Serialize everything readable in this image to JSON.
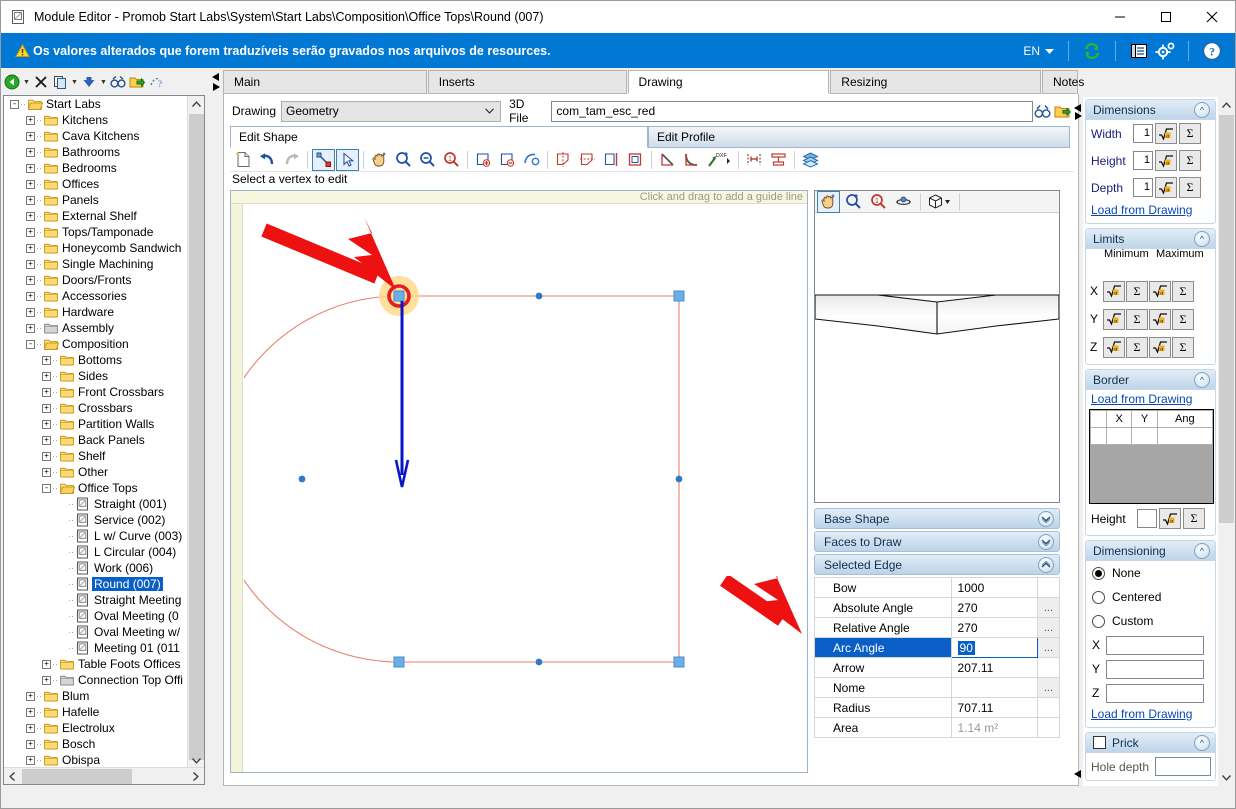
{
  "window": {
    "title": "Module Editor - Promob Start Labs\\System\\Start Labs\\Composition\\Office Tops\\Round (007)",
    "minimize": "—",
    "maximize": "☐",
    "close": "✕"
  },
  "notification": {
    "message": "Os valores alterados que forem traduzíveis serão gravados nos arquivos de resources.",
    "language": "EN",
    "icons": [
      "refresh-icon",
      "report-icon",
      "settings-icon",
      "help-icon"
    ]
  },
  "left_toolbar": {
    "buttons": [
      "back-icon",
      "delete-icon",
      "copy-icon",
      "move-down-icon",
      "find-icon",
      "export-icon",
      "unknown-icon"
    ]
  },
  "tree": {
    "root": "Start Labs",
    "items": [
      {
        "label": "Start Labs",
        "depth": 0,
        "exp": "-",
        "icon": "open-folder",
        "selected": false
      },
      {
        "label": "Kitchens",
        "depth": 1,
        "exp": "+",
        "icon": "folder",
        "selected": false
      },
      {
        "label": "Cava Kitchens",
        "depth": 1,
        "exp": "+",
        "icon": "folder",
        "selected": false
      },
      {
        "label": "Bathrooms",
        "depth": 1,
        "exp": "+",
        "icon": "folder",
        "selected": false
      },
      {
        "label": "Bedrooms",
        "depth": 1,
        "exp": "+",
        "icon": "folder",
        "selected": false
      },
      {
        "label": "Offices",
        "depth": 1,
        "exp": "+",
        "icon": "folder",
        "selected": false
      },
      {
        "label": "Panels",
        "depth": 1,
        "exp": "+",
        "icon": "folder",
        "selected": false
      },
      {
        "label": "External Shelf",
        "depth": 1,
        "exp": "+",
        "icon": "folder",
        "selected": false
      },
      {
        "label": "Tops/Tamponade",
        "depth": 1,
        "exp": "+",
        "icon": "folder",
        "selected": false
      },
      {
        "label": "Honeycomb Sandwich",
        "depth": 1,
        "exp": "+",
        "icon": "folder",
        "selected": false
      },
      {
        "label": "Single Machining",
        "depth": 1,
        "exp": "+",
        "icon": "folder",
        "selected": false
      },
      {
        "label": "Doors/Fronts",
        "depth": 1,
        "exp": "+",
        "icon": "folder",
        "selected": false
      },
      {
        "label": "Accessories",
        "depth": 1,
        "exp": "+",
        "icon": "folder",
        "selected": false
      },
      {
        "label": "Hardware",
        "depth": 1,
        "exp": "+",
        "icon": "folder",
        "selected": false
      },
      {
        "label": "Assembly",
        "depth": 1,
        "exp": "+",
        "icon": "folder-grey",
        "selected": false
      },
      {
        "label": "Composition",
        "depth": 1,
        "exp": "-",
        "icon": "open-folder",
        "selected": false
      },
      {
        "label": "Bottoms",
        "depth": 2,
        "exp": "+",
        "icon": "folder",
        "selected": false
      },
      {
        "label": "Sides",
        "depth": 2,
        "exp": "+",
        "icon": "folder",
        "selected": false
      },
      {
        "label": "Front Crossbars",
        "depth": 2,
        "exp": "+",
        "icon": "folder",
        "selected": false
      },
      {
        "label": "Crossbars",
        "depth": 2,
        "exp": "+",
        "icon": "folder",
        "selected": false
      },
      {
        "label": "Partition Walls",
        "depth": 2,
        "exp": "+",
        "icon": "folder",
        "selected": false
      },
      {
        "label": "Back Panels",
        "depth": 2,
        "exp": "+",
        "icon": "folder",
        "selected": false
      },
      {
        "label": "Shelf",
        "depth": 2,
        "exp": "+",
        "icon": "folder",
        "selected": false
      },
      {
        "label": "Other",
        "depth": 2,
        "exp": "+",
        "icon": "folder",
        "selected": false
      },
      {
        "label": "Office Tops",
        "depth": 2,
        "exp": "-",
        "icon": "open-folder",
        "selected": false
      },
      {
        "label": "Straight (001)",
        "depth": 3,
        "exp": "",
        "icon": "module",
        "selected": false
      },
      {
        "label": "Service (002)",
        "depth": 3,
        "exp": "",
        "icon": "module",
        "selected": false
      },
      {
        "label": "L w/ Curve (003)",
        "depth": 3,
        "exp": "",
        "icon": "module",
        "selected": false
      },
      {
        "label": "L Circular (004)",
        "depth": 3,
        "exp": "",
        "icon": "module",
        "selected": false
      },
      {
        "label": "Work (006)",
        "depth": 3,
        "exp": "",
        "icon": "module",
        "selected": false
      },
      {
        "label": "Round (007)",
        "depth": 3,
        "exp": "",
        "icon": "module",
        "selected": true
      },
      {
        "label": "Straight Meeting",
        "depth": 3,
        "exp": "",
        "icon": "module",
        "selected": false
      },
      {
        "label": "Oval Meeting (0",
        "depth": 3,
        "exp": "",
        "icon": "module",
        "selected": false
      },
      {
        "label": "Oval Meeting w/",
        "depth": 3,
        "exp": "",
        "icon": "module",
        "selected": false
      },
      {
        "label": "Meeting 01 (011",
        "depth": 3,
        "exp": "",
        "icon": "module",
        "selected": false
      },
      {
        "label": "Table Foots Offices",
        "depth": 2,
        "exp": "+",
        "icon": "folder",
        "selected": false
      },
      {
        "label": "Connection Top Offi",
        "depth": 2,
        "exp": "+",
        "icon": "folder-grey",
        "selected": false
      },
      {
        "label": "Blum",
        "depth": 1,
        "exp": "+",
        "icon": "folder",
        "selected": false
      },
      {
        "label": "Hafelle",
        "depth": 1,
        "exp": "+",
        "icon": "folder",
        "selected": false
      },
      {
        "label": "Electrolux",
        "depth": 1,
        "exp": "+",
        "icon": "folder",
        "selected": false
      },
      {
        "label": "Bosch",
        "depth": 1,
        "exp": "+",
        "icon": "folder",
        "selected": false
      },
      {
        "label": "Obispa",
        "depth": 1,
        "exp": "+",
        "icon": "folder",
        "selected": false
      }
    ]
  },
  "tabs": [
    {
      "label": "Main",
      "active": false
    },
    {
      "label": "Inserts",
      "active": false
    },
    {
      "label": "Drawing",
      "active": true
    },
    {
      "label": "Resizing",
      "active": false
    },
    {
      "label": "Notes",
      "active": false
    }
  ],
  "drawing_row": {
    "drawing_label": "Drawing",
    "drawing_value": "Geometry",
    "file_label": "3D File",
    "file_value": "com_tam_esc_red",
    "buttons": [
      "binoculars-icon",
      "open-folder-icon"
    ]
  },
  "sub_tabs": [
    {
      "label": "Edit Shape",
      "active": true
    },
    {
      "label": "Edit Profile",
      "active": false
    }
  ],
  "shape_toolbar": {
    "buttons": [
      "new-shape-icon",
      "undo-icon",
      "redo-icon",
      "edit-vertex-icon",
      "select-icon",
      "pan-icon",
      "zoom-fit-icon",
      "zoom-out-icon",
      "zoom-in-icon",
      "add-vertex-icon",
      "remove-vertex-icon",
      "curve-icon",
      "mirror-vertical-icon",
      "mirror-horizontal-icon",
      "flip-icon",
      "rectangle-icon",
      "chamfer-icon",
      "fillet-icon",
      "dxf-icon",
      "measure-icon",
      "align-icon",
      "layers-icon"
    ]
  },
  "hint": "Select a vertex to edit",
  "canvas": {
    "guide_hint": "Click and drag to add a guide line"
  },
  "preview_toolbar": {
    "buttons": [
      "pan-icon",
      "zoom-window-icon",
      "zoom-icon",
      "rotate-icon",
      "view-cube-icon"
    ]
  },
  "accordions": [
    {
      "title": "Base Shape",
      "state": "collapsed",
      "chevron": "˅"
    },
    {
      "title": "Faces to Draw",
      "state": "collapsed",
      "chevron": "˅"
    },
    {
      "title": "Selected Edge",
      "state": "expanded",
      "chevron": "˄"
    }
  ],
  "selected_edge": {
    "rows": [
      {
        "key": "Bow",
        "value": "1000",
        "dots": false,
        "selected": false,
        "grey": false,
        "editing": false
      },
      {
        "key": "Absolute Angle",
        "value": "270",
        "dots": true,
        "selected": false,
        "grey": false,
        "editing": false
      },
      {
        "key": "Relative Angle",
        "value": "270",
        "dots": true,
        "selected": false,
        "grey": false,
        "editing": false
      },
      {
        "key": "Arc Angle",
        "value": "90",
        "dots": true,
        "selected": true,
        "grey": false,
        "editing": true
      },
      {
        "key": "Arrow",
        "value": "207.11",
        "dots": false,
        "selected": false,
        "grey": false,
        "editing": false
      },
      {
        "key": "Nome",
        "value": "",
        "dots": true,
        "selected": false,
        "grey": false,
        "editing": false
      },
      {
        "key": "Radius",
        "value": "707.11",
        "dots": false,
        "selected": false,
        "grey": false,
        "editing": false
      },
      {
        "key": "Area",
        "value": "1.14 m²",
        "dots": false,
        "selected": false,
        "grey": true,
        "editing": false
      }
    ]
  },
  "right_panel": {
    "dimensions": {
      "title": "Dimensions",
      "rows": [
        {
          "label": "Width",
          "value": "1"
        },
        {
          "label": "Height",
          "value": "1"
        },
        {
          "label": "Depth",
          "value": "1"
        }
      ],
      "load_link": "Load from Drawing"
    },
    "limits": {
      "title": "Limits",
      "col_min": "Minimum",
      "col_max": "Maximum",
      "axes": [
        "X",
        "Y",
        "Z"
      ],
      "load_link": "Load from Drawing"
    },
    "border": {
      "title": "Border",
      "load_link": "Load from Drawing",
      "columns": [
        "",
        "X",
        "Y",
        "Ang"
      ],
      "height_label": "Height",
      "height_value": ""
    },
    "dimensioning": {
      "title": "Dimensioning",
      "options": [
        {
          "label": "None",
          "checked": true
        },
        {
          "label": "Centered",
          "checked": false
        },
        {
          "label": "Custom",
          "checked": false
        }
      ],
      "axes": [
        {
          "label": "X",
          "value": ""
        },
        {
          "label": "Y",
          "value": ""
        },
        {
          "label": "Z",
          "value": ""
        }
      ],
      "load_link": "Load from Drawing"
    },
    "prick": {
      "title": "Prick",
      "checked": false,
      "hole_depth_label": "Hole depth",
      "hole_depth_value": ""
    }
  }
}
